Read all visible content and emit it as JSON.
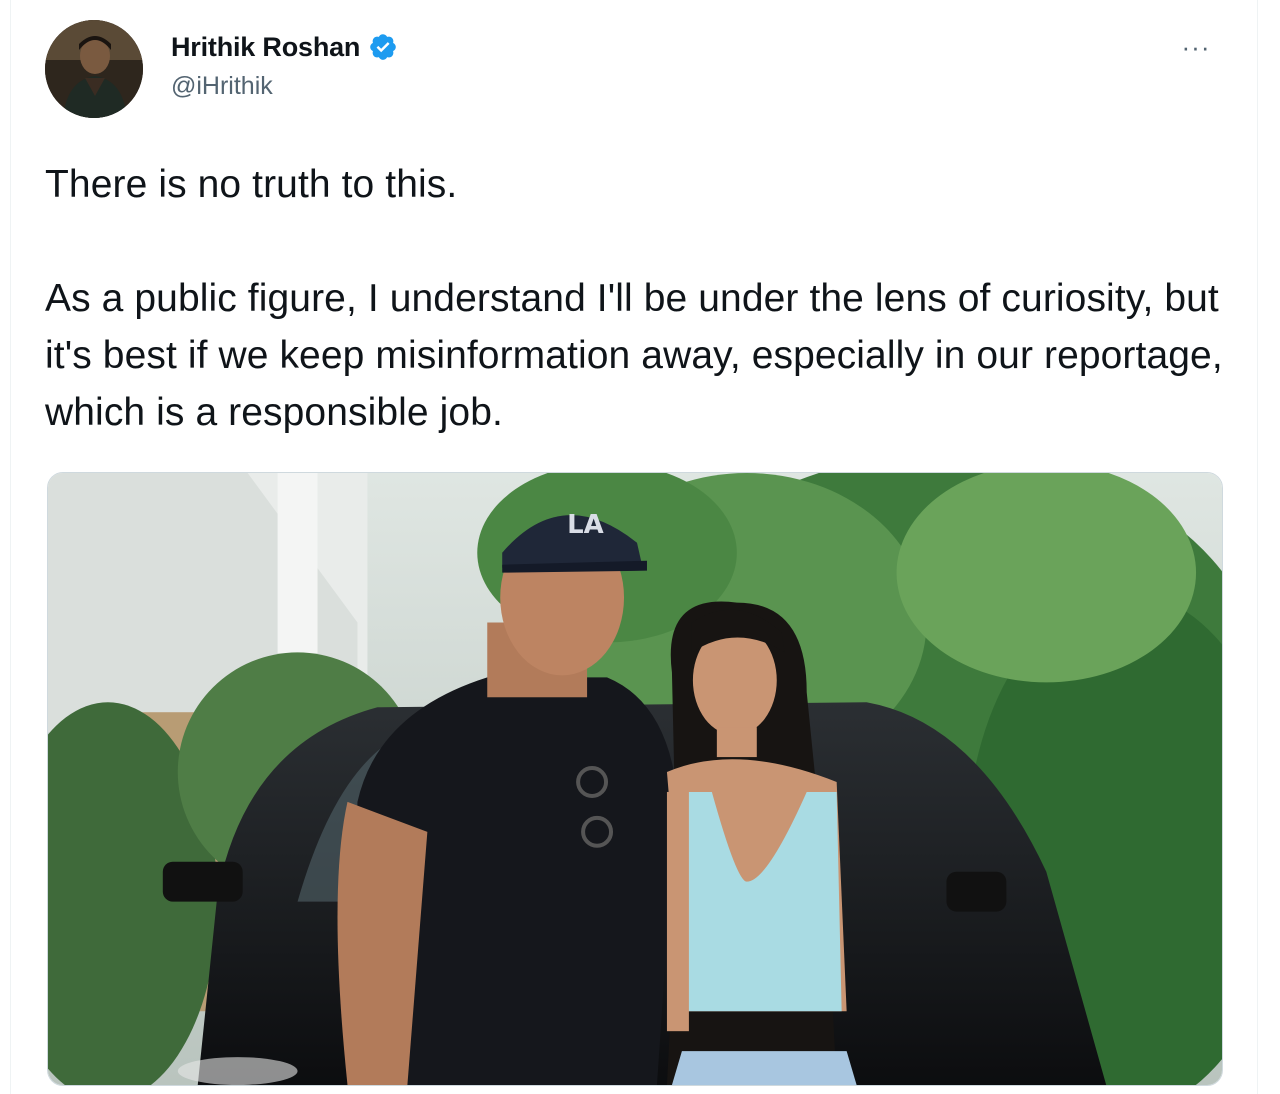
{
  "author": {
    "display_name": "Hrithik Roshan",
    "handle": "@iHrithik",
    "verified": true,
    "avatar_icon": "profile-photo"
  },
  "tweet": {
    "paragraphs": [
      "There is no truth to this.",
      "As a public figure, I understand I'll be under the lens of curiosity, but it's best if we keep misinformation away, especially in our reportage, which is a responsible job."
    ]
  },
  "menu": {
    "more_label": "···"
  },
  "media": {
    "description_icon": "photo-two-people-in-front-of-car",
    "cap_logo": "LA"
  },
  "colors": {
    "verified_blue": "#1d9bf0",
    "text_primary": "#0f1419",
    "text_secondary": "#536471"
  }
}
